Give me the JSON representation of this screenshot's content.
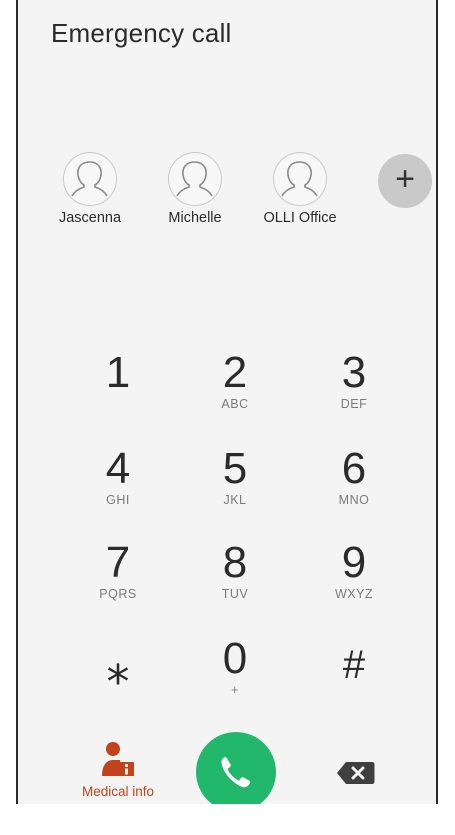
{
  "header": {
    "title": "Emergency call"
  },
  "contacts": [
    {
      "name": "Jascenna",
      "icon": "person-icon"
    },
    {
      "name": "Michelle",
      "icon": "person-icon"
    },
    {
      "name": "OLLI Office",
      "icon": "person-icon"
    }
  ],
  "add_contact": {
    "icon": "plus-icon",
    "glyph": "+"
  },
  "keypad": [
    {
      "digit": "1",
      "letters": ""
    },
    {
      "digit": "2",
      "letters": "ABC"
    },
    {
      "digit": "3",
      "letters": "DEF"
    },
    {
      "digit": "4",
      "letters": "GHI"
    },
    {
      "digit": "5",
      "letters": "JKL"
    },
    {
      "digit": "6",
      "letters": "MNO"
    },
    {
      "digit": "7",
      "letters": "PQRS"
    },
    {
      "digit": "8",
      "letters": "TUV"
    },
    {
      "digit": "9",
      "letters": "WXYZ"
    },
    {
      "digit": "⁎",
      "letters": ""
    },
    {
      "digit": "0",
      "letters": "+"
    },
    {
      "digit": "#",
      "letters": ""
    }
  ],
  "bottom_bar": {
    "medical_info_label": "Medical info",
    "medical_icon": "medical-info-icon",
    "call_icon": "phone-icon",
    "backspace_icon": "backspace-icon"
  },
  "colors": {
    "accent_call": "#22b86c",
    "medical": "#c2431b",
    "background": "#f4f4f4"
  }
}
